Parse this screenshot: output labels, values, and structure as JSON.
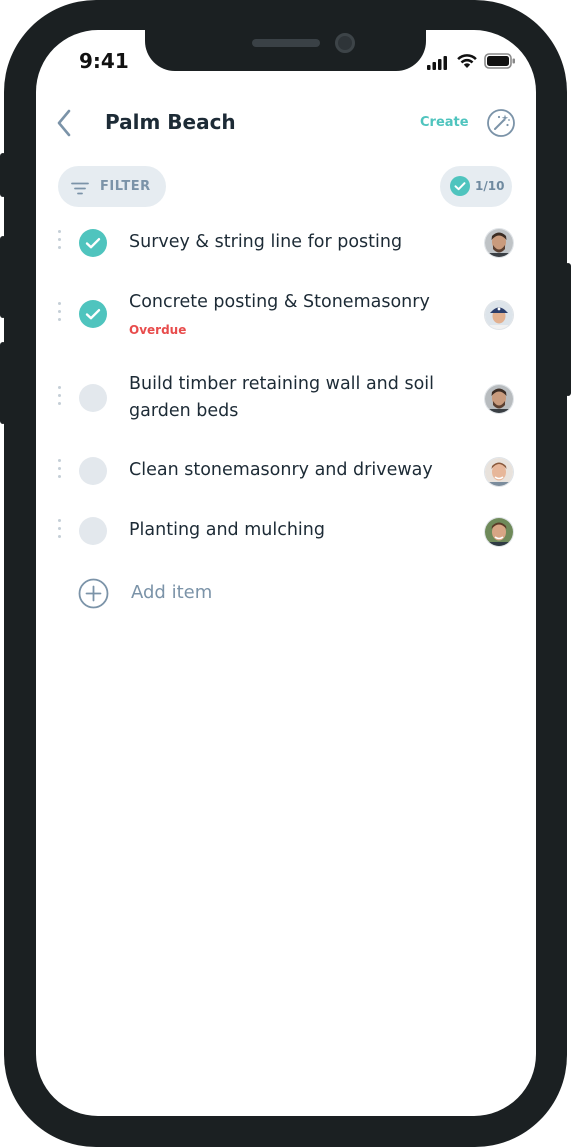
{
  "status_bar": {
    "time": "9:41"
  },
  "header": {
    "title": "Palm Beach",
    "create_label": "Create"
  },
  "toolbar": {
    "filter_label": "FILTER",
    "progress_label": "1/10"
  },
  "items": [
    {
      "text": "Survey & string line for posting",
      "done": true,
      "badge": ""
    },
    {
      "text": "Concrete posting & Stonemasonry",
      "done": true,
      "badge": "Overdue"
    },
    {
      "text": "Build timber retaining wall and soil garden beds",
      "done": false,
      "badge": ""
    },
    {
      "text": "Clean stonemasonry and driveway",
      "done": false,
      "badge": ""
    },
    {
      "text": "Planting and mulching",
      "done": false,
      "badge": ""
    }
  ],
  "add_item_label": "Add item",
  "colors": {
    "accent": "#4fc4be",
    "overdue": "#e84c4c",
    "muted": "#7b93a8"
  }
}
